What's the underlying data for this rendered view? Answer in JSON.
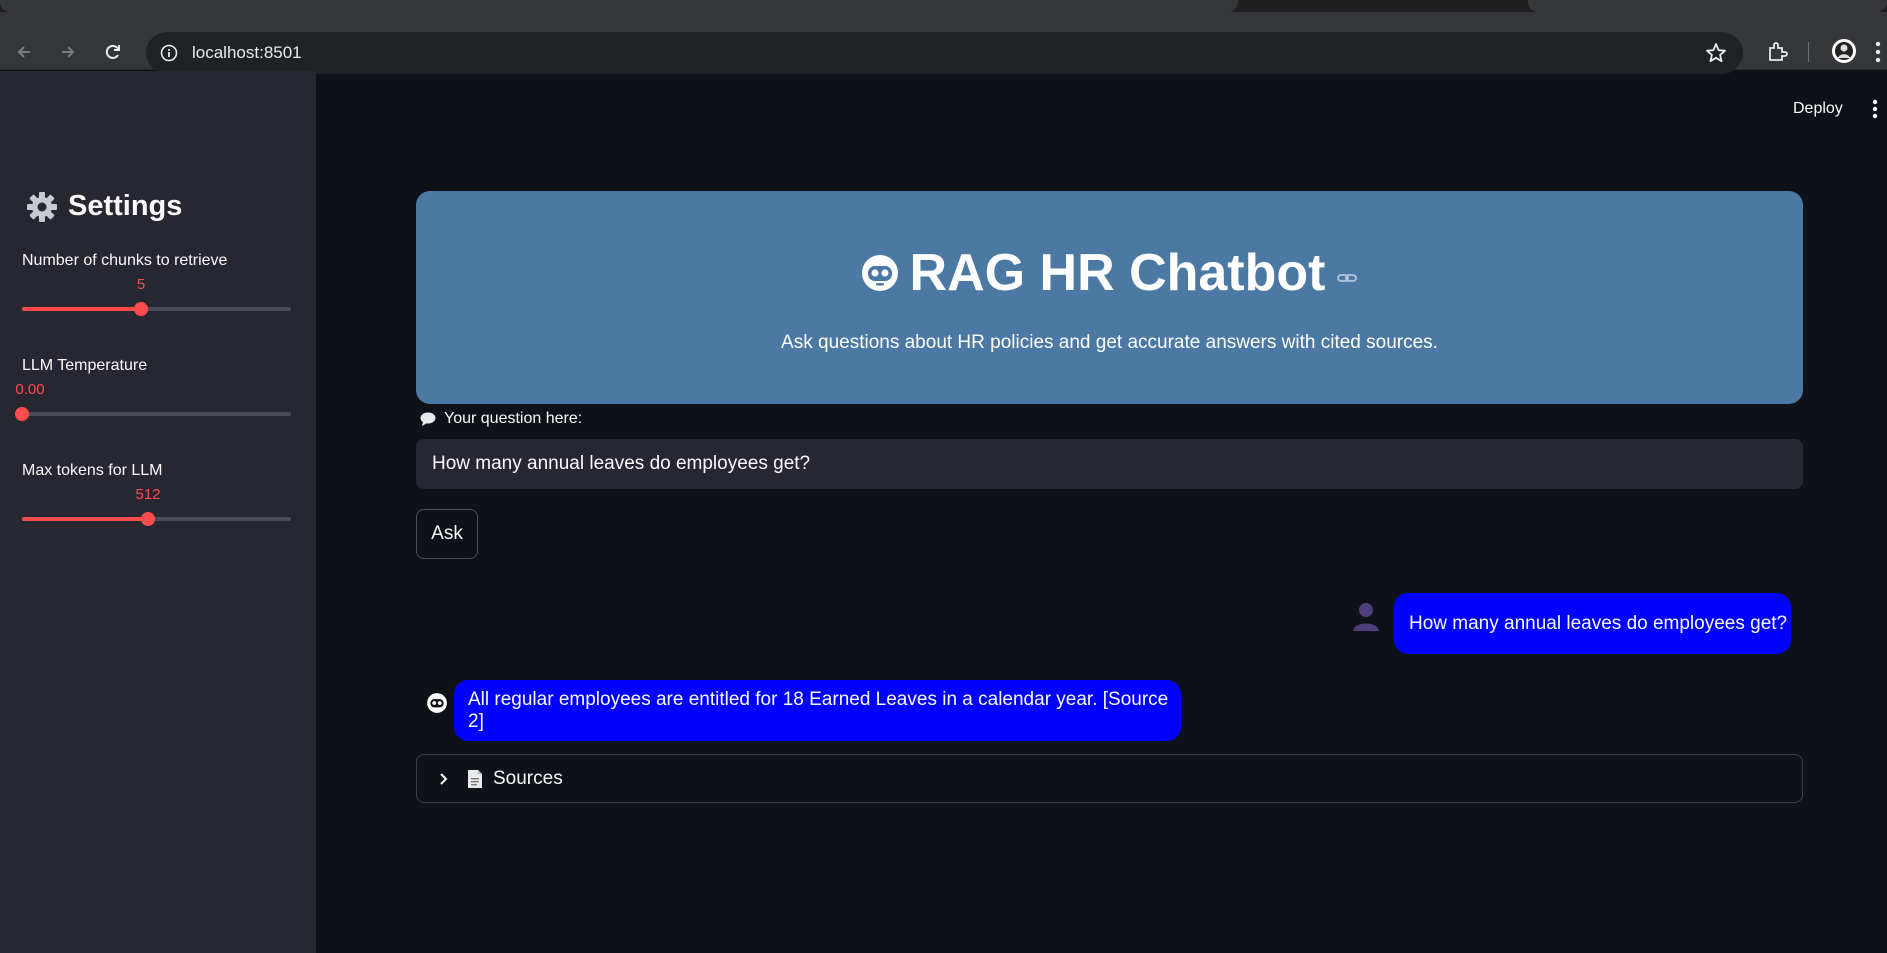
{
  "browser": {
    "url": "localhost:8501"
  },
  "app": {
    "deploy_label": "Deploy"
  },
  "sidebar": {
    "title": "Settings",
    "sliders": [
      {
        "label": "Number of chunks to retrieve",
        "value": "5",
        "fraction": 0.444
      },
      {
        "label": "LLM Temperature",
        "value": "0.00",
        "fraction": 0.0
      },
      {
        "label": "Max tokens for LLM",
        "value": "512",
        "fraction": 0.47
      }
    ]
  },
  "hero": {
    "title": "RAG HR Chatbot",
    "subtitle": "Ask questions about HR policies and get accurate answers with cited sources."
  },
  "question": {
    "label": "Your question here:",
    "value": "How many annual leaves do employees get?",
    "ask_label": "Ask"
  },
  "chat": {
    "user_message": "How many annual leaves do employees get?",
    "bot_message": "All regular employees are entitled for 18 Earned Leaves in a calendar year. [Source 2]"
  },
  "sources": {
    "label": "Sources"
  },
  "colors": {
    "accent": "#ff4b4b",
    "hero_bg": "#4b79a4",
    "bubble": "#0000ff",
    "sidebar_bg": "#262730",
    "main_bg": "#0e1117"
  },
  "icons": {
    "sidebar_title": "gear-icon",
    "hero_title": "robot-icon",
    "question_label": "speech-bubble-icon",
    "user_avatar": "user-icon",
    "bot_avatar": "robot-icon",
    "sources": "document-icon",
    "expander": "chevron-right-icon"
  }
}
